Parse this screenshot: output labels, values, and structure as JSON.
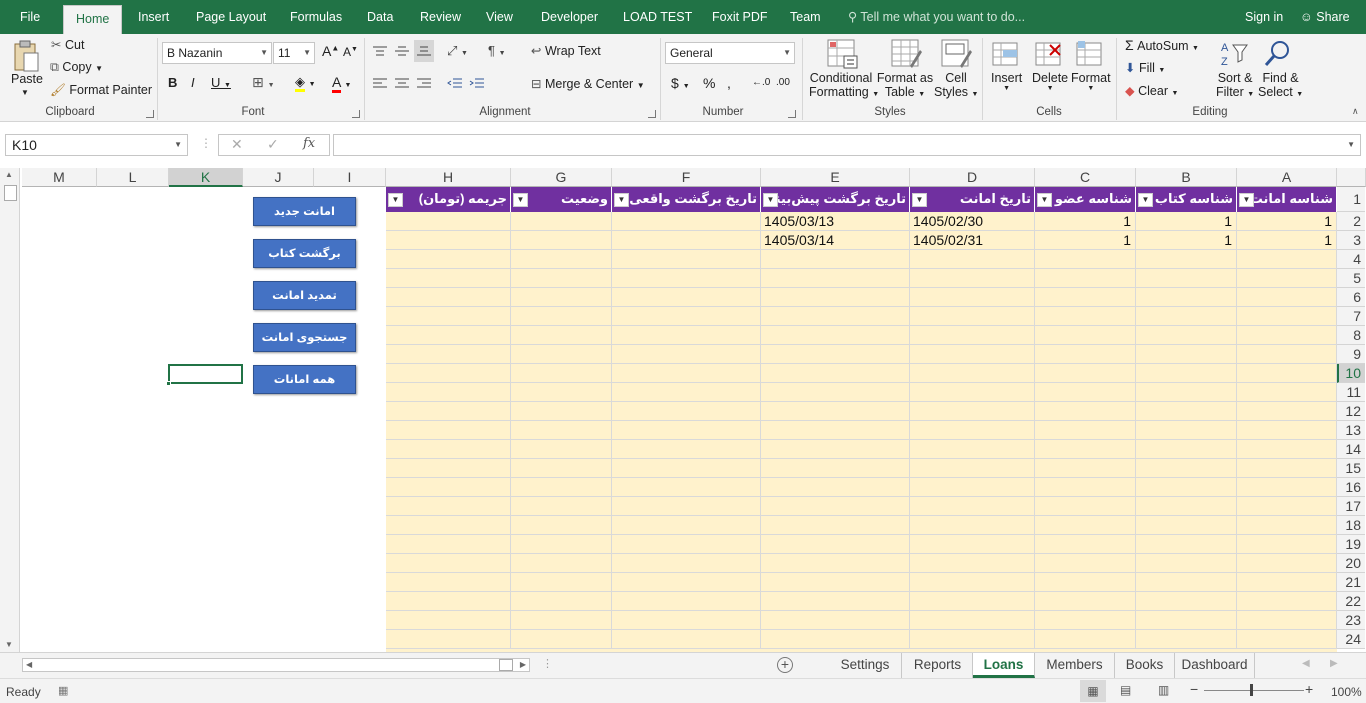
{
  "ribbon_tabs": [
    "File",
    "Home",
    "Insert",
    "Page Layout",
    "Formulas",
    "Data",
    "Review",
    "View",
    "Developer",
    "LOAD TEST",
    "Foxit PDF",
    "Team"
  ],
  "active_tab": "Home",
  "tell_me": "Tell me what you want to do...",
  "sign_in": "Sign in",
  "share": "Share",
  "clipboard": {
    "paste": "Paste",
    "cut": "Cut",
    "copy": "Copy",
    "format_painter": "Format Painter",
    "group": "Clipboard"
  },
  "font": {
    "name": "B Nazanin",
    "size": "11",
    "group": "Font"
  },
  "alignment": {
    "wrap": "Wrap Text",
    "merge": "Merge & Center",
    "group": "Alignment"
  },
  "number": {
    "format": "General",
    "group": "Number"
  },
  "styles": {
    "conditional": "Conditional",
    "conditional2": "Formatting",
    "format_as": "Format as",
    "table": "Table",
    "cell": "Cell",
    "cell2": "Styles",
    "group": "Styles"
  },
  "cells": {
    "insert": "Insert",
    "delete": "Delete",
    "format": "Format",
    "group": "Cells"
  },
  "editing": {
    "autosum": "AutoSum",
    "fill": "Fill",
    "clear": "Clear",
    "sort": "Sort &",
    "filter": "Filter",
    "find": "Find &",
    "select": "Select",
    "group": "Editing"
  },
  "namebox": "K10",
  "columns": [
    "A",
    "B",
    "C",
    "D",
    "E",
    "F",
    "G",
    "H",
    "I",
    "J",
    "K",
    "L",
    "M"
  ],
  "headers": [
    "شناسه امانت",
    "شناسه کتاب",
    "شناسه عضو",
    "تاریخ امانت",
    "تاریخ برگشت پیش‌بینی",
    "تاریخ برگشت واقعی",
    "وضعیت",
    "جریمه (تومان)"
  ],
  "rows": [
    {
      "A": "1",
      "B": "1",
      "C": "1",
      "D": "1405/02/30",
      "E": "1405/03/13",
      "F": "",
      "G": "",
      "H": ""
    },
    {
      "A": "1",
      "B": "1",
      "C": "1",
      "D": "1405/02/31",
      "E": "1405/03/14",
      "F": "",
      "G": "",
      "H": ""
    }
  ],
  "row_numbers": [
    "1",
    "2",
    "3",
    "4",
    "5",
    "6",
    "7",
    "8",
    "9",
    "10",
    "11",
    "12",
    "13",
    "14",
    "15",
    "16",
    "17",
    "18",
    "19",
    "20",
    "21",
    "22",
    "23",
    "24"
  ],
  "buttons": [
    "امانت جدید",
    "برگشت کتاب",
    "تمدید امانت",
    "جستجوی امانت",
    "همه امانات"
  ],
  "sheet_tabs": [
    "Settings",
    "Reports",
    "Loans",
    "Members",
    "Books",
    "Dashboard"
  ],
  "active_sheet": "Loans",
  "status": "Ready",
  "zoom": "100%",
  "colors": {
    "excel_green": "#217346",
    "header_purple": "#7030a0",
    "body_yellow": "#fff2cc",
    "button_blue": "#4472c4"
  }
}
